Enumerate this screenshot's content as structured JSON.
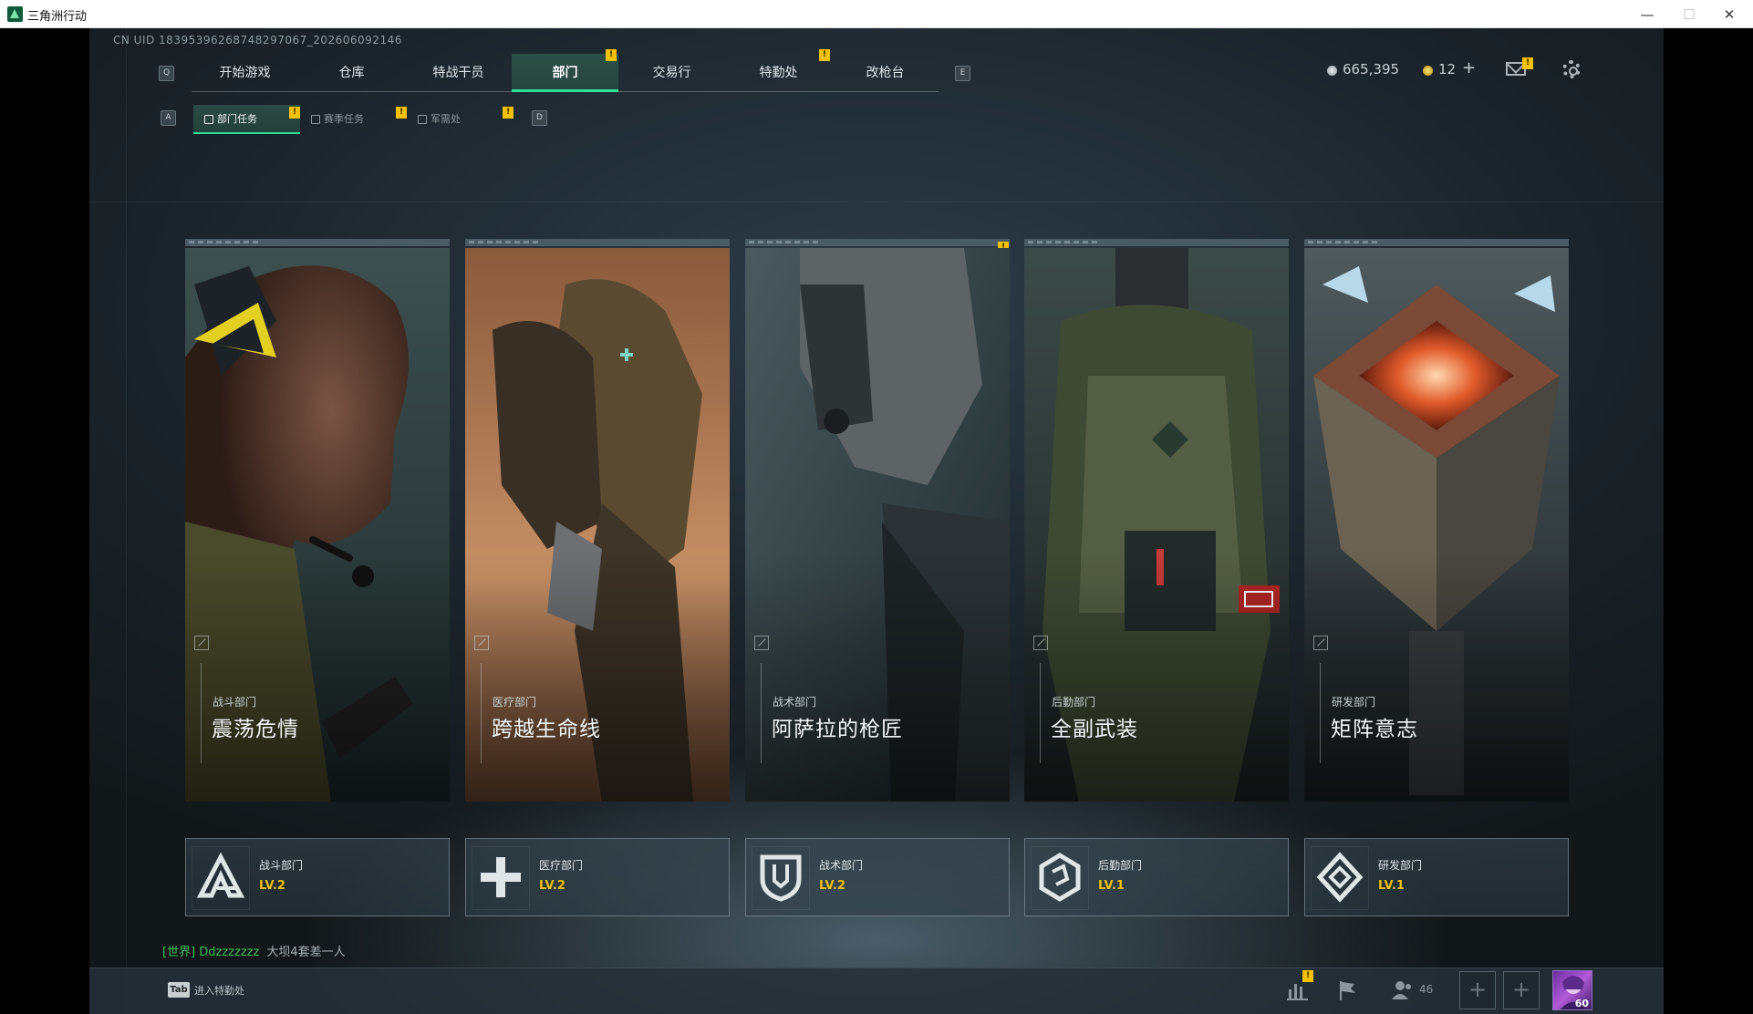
{
  "window": {
    "title": "三角洲行动",
    "controls": {
      "minimize": "—",
      "maximize": "☐",
      "close": "✕"
    }
  },
  "uid_text": "CN UID 18395396268748297067_202606092146",
  "nav": {
    "key_left": "Q",
    "key_right": "E",
    "tabs": [
      {
        "label": "开始游戏",
        "badge": ""
      },
      {
        "label": "仓库",
        "badge": ""
      },
      {
        "label": "特战干员",
        "badge": ""
      },
      {
        "label": "部门",
        "badge": "!",
        "active": true
      },
      {
        "label": "交易行",
        "badge": ""
      },
      {
        "label": "特勤处",
        "badge": "!"
      },
      {
        "label": "改枪台",
        "badge": ""
      }
    ]
  },
  "subnav": {
    "key_left": "A",
    "key_right": "D",
    "tabs": [
      {
        "label": "部门任务",
        "badge": "!",
        "active": true
      },
      {
        "label": "赛季任务",
        "badge": "!"
      },
      {
        "label": "军需处",
        "badge": "!"
      }
    ]
  },
  "currency": {
    "silver": "665,395",
    "gold": "12",
    "add": "+",
    "mail_badge": "!"
  },
  "departments": [
    {
      "dept": "战斗部门",
      "event": "震荡危情",
      "level": "LV.2",
      "emblem": "combat-emblem-icon",
      "badge": ""
    },
    {
      "dept": "医疗部门",
      "event": "跨越生命线",
      "level": "LV.2",
      "emblem": "medical-cross-icon",
      "badge": ""
    },
    {
      "dept": "战术部门",
      "event": "阿萨拉的枪匠",
      "level": "LV.2",
      "emblem": "tactical-shield-icon",
      "badge": "!"
    },
    {
      "dept": "后勤部门",
      "event": "全副武装",
      "level": "LV.1",
      "emblem": "logistics-hex-icon",
      "badge": ""
    },
    {
      "dept": "研发部门",
      "event": "矩阵意志",
      "level": "LV.1",
      "emblem": "research-diamond-icon",
      "badge": ""
    }
  ],
  "chat": {
    "who": "[世界] Ddzzzzzzz",
    "message": "大坝4套差一人"
  },
  "bottom": {
    "tab_key": "Tab",
    "tab_label": "进入特勤处",
    "stats_badge": "!",
    "friends_count": "46",
    "avatar_level": "60",
    "slot_plus": "+"
  },
  "colors": {
    "accent": "#2ee09a",
    "badge": "#f2c200",
    "level": "#f2c200"
  }
}
